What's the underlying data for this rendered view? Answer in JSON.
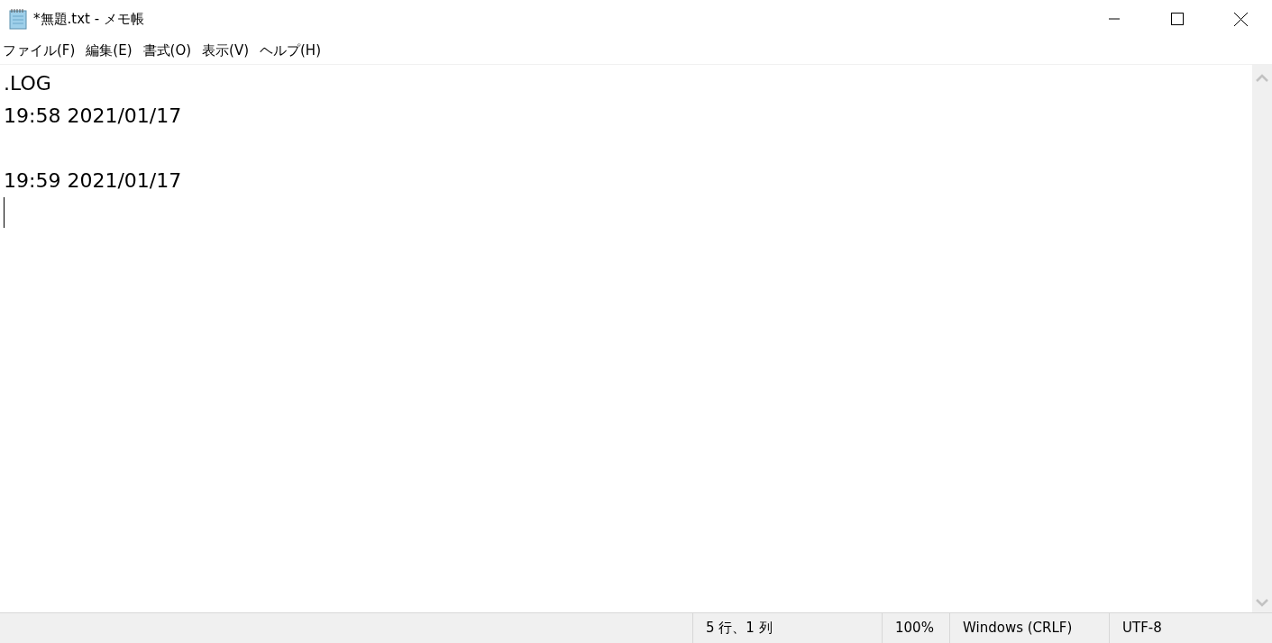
{
  "window": {
    "title": "*無題.txt - メモ帳"
  },
  "menu": [
    "ファイル(F)",
    "編集(E)",
    "書式(O)",
    "表示(V)",
    "ヘルプ(H)"
  ],
  "editor": {
    "content": ".LOG\n19:58 2021/01/17\n\n19:59 2021/01/17\n"
  },
  "status_bar": [
    "5 行、1 列",
    "100%",
    "Windows (CRLF)",
    "UTF-8"
  ]
}
